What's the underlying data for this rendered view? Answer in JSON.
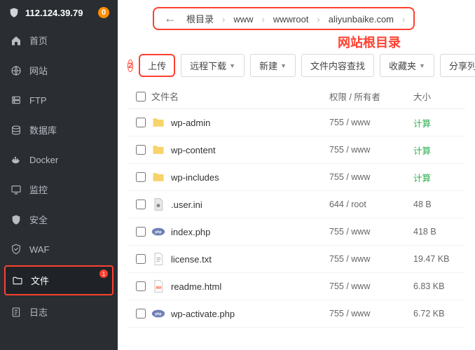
{
  "server_ip": "112.124.39.79",
  "ip_badge": "0",
  "sidebar": {
    "items": [
      {
        "label": "首页",
        "icon": "home-icon"
      },
      {
        "label": "网站",
        "icon": "globe-icon"
      },
      {
        "label": "FTP",
        "icon": "server-icon"
      },
      {
        "label": "数据库",
        "icon": "database-icon"
      },
      {
        "label": "Docker",
        "icon": "docker-icon"
      },
      {
        "label": "监控",
        "icon": "monitor-icon"
      },
      {
        "label": "安全",
        "icon": "shield-icon"
      },
      {
        "label": "WAF",
        "icon": "waf-icon"
      },
      {
        "label": "文件",
        "icon": "folder-icon",
        "active": true,
        "marker": "1"
      },
      {
        "label": "日志",
        "icon": "log-icon"
      }
    ]
  },
  "breadcrumb": [
    "根目录",
    "www",
    "wwwroot",
    "aliyunbaike.com"
  ],
  "annotation": "网站根目录",
  "toolbar_marker": "2",
  "toolbar": {
    "upload": "上传",
    "remote": "远程下载",
    "new": "新建",
    "search": "文件内容查找",
    "fav": "收藏夹",
    "share": "分享列表"
  },
  "columns": {
    "name": "文件名",
    "perm": "权限 / 所有者",
    "size": "大小"
  },
  "calc_label": "计算",
  "files": [
    {
      "name": "wp-admin",
      "type": "folder",
      "perm": "755 / www",
      "size": "calc"
    },
    {
      "name": "wp-content",
      "type": "folder",
      "perm": "755 / www",
      "size": "calc"
    },
    {
      "name": "wp-includes",
      "type": "folder",
      "perm": "755 / www",
      "size": "calc"
    },
    {
      "name": ".user.ini",
      "type": "ini",
      "perm": "644 / root",
      "size": "48 B"
    },
    {
      "name": "index.php",
      "type": "php",
      "perm": "755 / www",
      "size": "418 B"
    },
    {
      "name": "license.txt",
      "type": "txt",
      "perm": "755 / www",
      "size": "19.47 KB"
    },
    {
      "name": "readme.html",
      "type": "html",
      "perm": "755 / www",
      "size": "6.83 KB"
    },
    {
      "name": "wp-activate.php",
      "type": "php",
      "perm": "755 / www",
      "size": "6.72 KB"
    }
  ]
}
